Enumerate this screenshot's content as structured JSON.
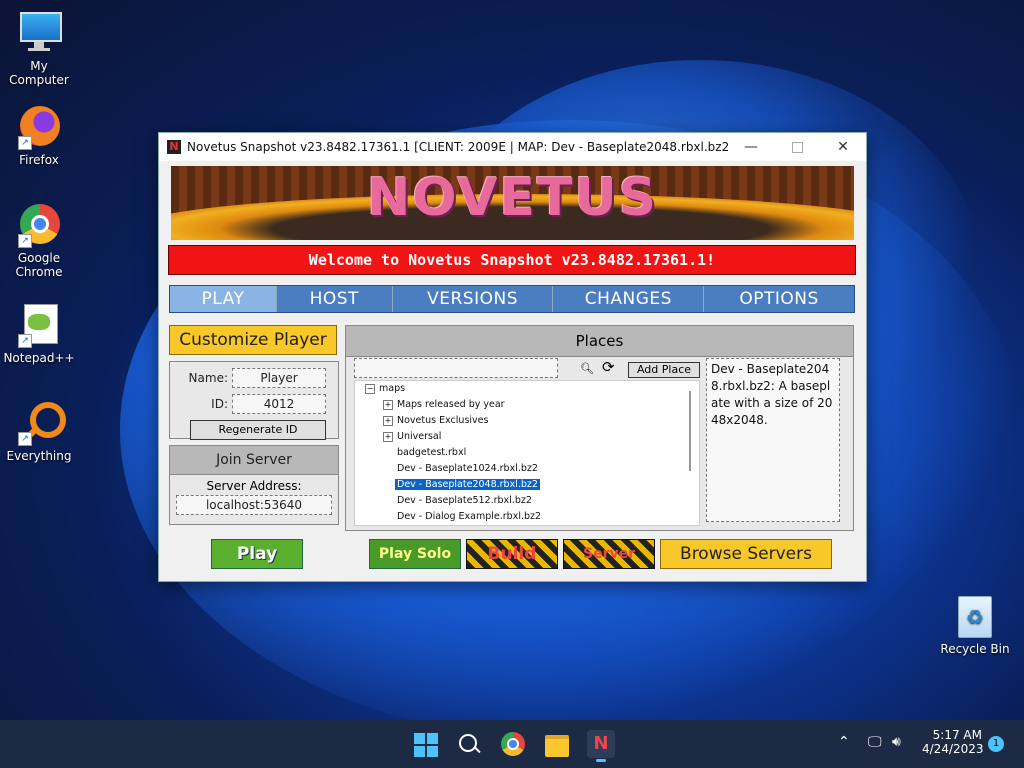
{
  "desktop": {
    "icons": [
      {
        "label": "My Computer"
      },
      {
        "label": "Firefox"
      },
      {
        "label": "Google Chrome"
      },
      {
        "label": "Notepad++"
      },
      {
        "label": "Everything"
      }
    ],
    "recycle_bin": "Recycle Bin"
  },
  "window": {
    "title": "Novetus Snapshot v23.8482.17361.1 [CLIENT: 2009E | MAP: Dev - Baseplate2048.rbxl.bz2]",
    "banner_logo": "NOVETUS",
    "welcome": "Welcome to Novetus Snapshot v23.8482.17361.1!",
    "tabs": [
      "PLAY",
      "HOST",
      "VERSIONS",
      "CHANGES",
      "OPTIONS"
    ],
    "active_tab": "PLAY",
    "customize_player": "Customize Player",
    "name_label": "Name:",
    "name_value": "Player",
    "id_label": "ID:",
    "id_value": "4012",
    "regenerate_id": "Regenerate ID",
    "join_server": "Join Server",
    "server_address_label": "Server Address:",
    "server_address_value": "localhost:53640",
    "places_title": "Places",
    "add_place": "Add Place",
    "tree": {
      "root": "maps",
      "items": [
        {
          "label": "Maps released by year",
          "expandable": true
        },
        {
          "label": "Novetus Exclusives",
          "expandable": true
        },
        {
          "label": "Universal",
          "expandable": true
        },
        {
          "label": "badgetest.rbxl",
          "expandable": false
        },
        {
          "label": "Dev - Baseplate1024.rbxl.bz2",
          "expandable": false
        },
        {
          "label": "Dev - Baseplate2048.rbxl.bz2",
          "expandable": false,
          "selected": true
        },
        {
          "label": "Dev - Baseplate512.rbxl.bz2",
          "expandable": false
        },
        {
          "label": "Dev - Dialog Example.rbxl.bz2",
          "expandable": false
        }
      ]
    },
    "description": "Dev - Baseplate2048.rbxl.bz2: A baseplate with a size of 2048x2048.",
    "buttons": {
      "play": "Play",
      "play_solo": "Play Solo",
      "build": "Build",
      "server": "Server",
      "browse_servers": "Browse Servers"
    }
  },
  "taskbar": {
    "time": "5:17 AM",
    "date": "4/24/2023",
    "notification_count": "1"
  }
}
